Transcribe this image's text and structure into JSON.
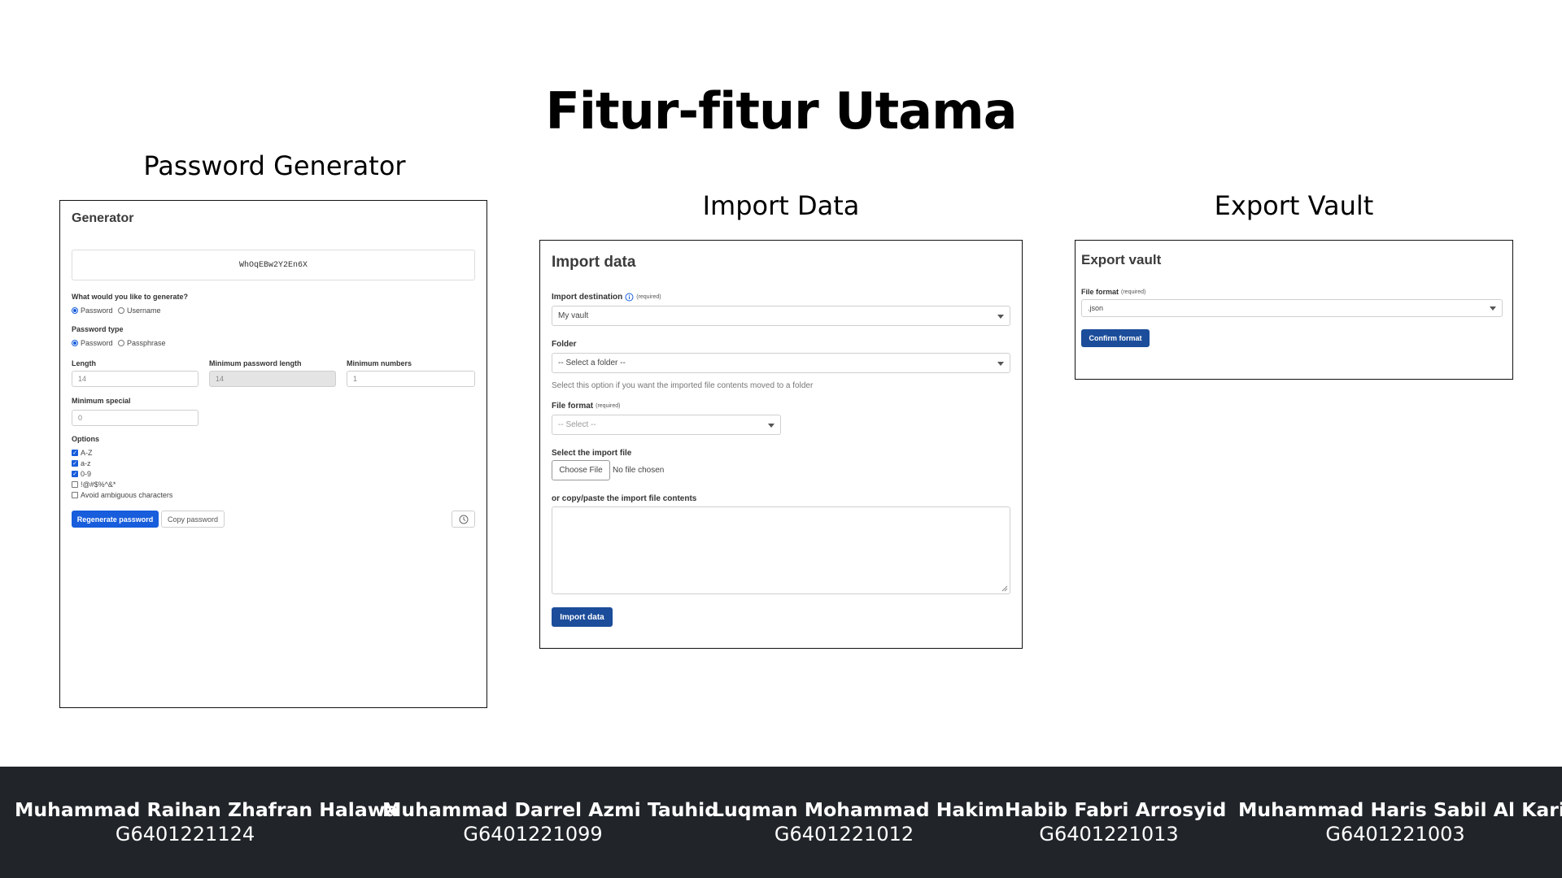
{
  "slide": {
    "title": "Fitur-fitur Utama"
  },
  "sections": {
    "generator": "Password Generator",
    "import": "Import Data",
    "export": "Export Vault"
  },
  "generator": {
    "heading": "Generator",
    "generated_password": "WhOqEBw2Y2En6X",
    "what_label": "What would you like to generate?",
    "what_options": [
      "Password",
      "Username"
    ],
    "type_label": "Password type",
    "type_options": [
      "Password",
      "Passphrase"
    ],
    "length_label": "Length",
    "length_value": "14",
    "min_length_label": "Minimum password length",
    "min_length_value": "14",
    "min_numbers_label": "Minimum numbers",
    "min_numbers_value": "1",
    "min_special_label": "Minimum special",
    "min_special_value": "0",
    "options_label": "Options",
    "options": [
      {
        "label": "A-Z",
        "checked": true
      },
      {
        "label": "a-z",
        "checked": true
      },
      {
        "label": "0-9",
        "checked": true
      },
      {
        "label": "!@#$%^&*",
        "checked": false
      },
      {
        "label": "Avoid ambiguous characters",
        "checked": false
      }
    ],
    "regenerate_label": "Regenerate password",
    "copy_label": "Copy password"
  },
  "import": {
    "heading": "Import data",
    "destination_label": "Import destination",
    "required_text": "(required)",
    "destination_value": "My vault",
    "folder_label": "Folder",
    "folder_value": "-- Select a folder --",
    "folder_help": "Select this option if you want the imported file contents moved to a folder",
    "format_label": "File format",
    "format_value": "-- Select --",
    "file_label": "Select the import file",
    "choose_file_label": "Choose File",
    "no_file_text": "No file chosen",
    "paste_label": "or copy/paste the import file contents",
    "paste_value": "",
    "submit_label": "Import data"
  },
  "export": {
    "heading": "Export vault",
    "format_label": "File format",
    "required_text": "(required)",
    "format_value": ".json",
    "confirm_label": "Confirm format"
  },
  "team": [
    {
      "name": "Muhammad Raihan Zhafran Halawa",
      "nim": "G6401221124"
    },
    {
      "name": "Muhammad Darrel Azmi Tauhid",
      "nim": "G6401221099"
    },
    {
      "name": "Luqman Mohammad Hakim",
      "nim": "G6401221012"
    },
    {
      "name": "Habib Fabri Arrosyid",
      "nim": "G6401221013"
    },
    {
      "name": "Muhammad Haris Sabil Al Karim",
      "nim": "G6401221003"
    }
  ],
  "colors": {
    "primary": "#175ddc",
    "footer_bg": "#212529"
  }
}
